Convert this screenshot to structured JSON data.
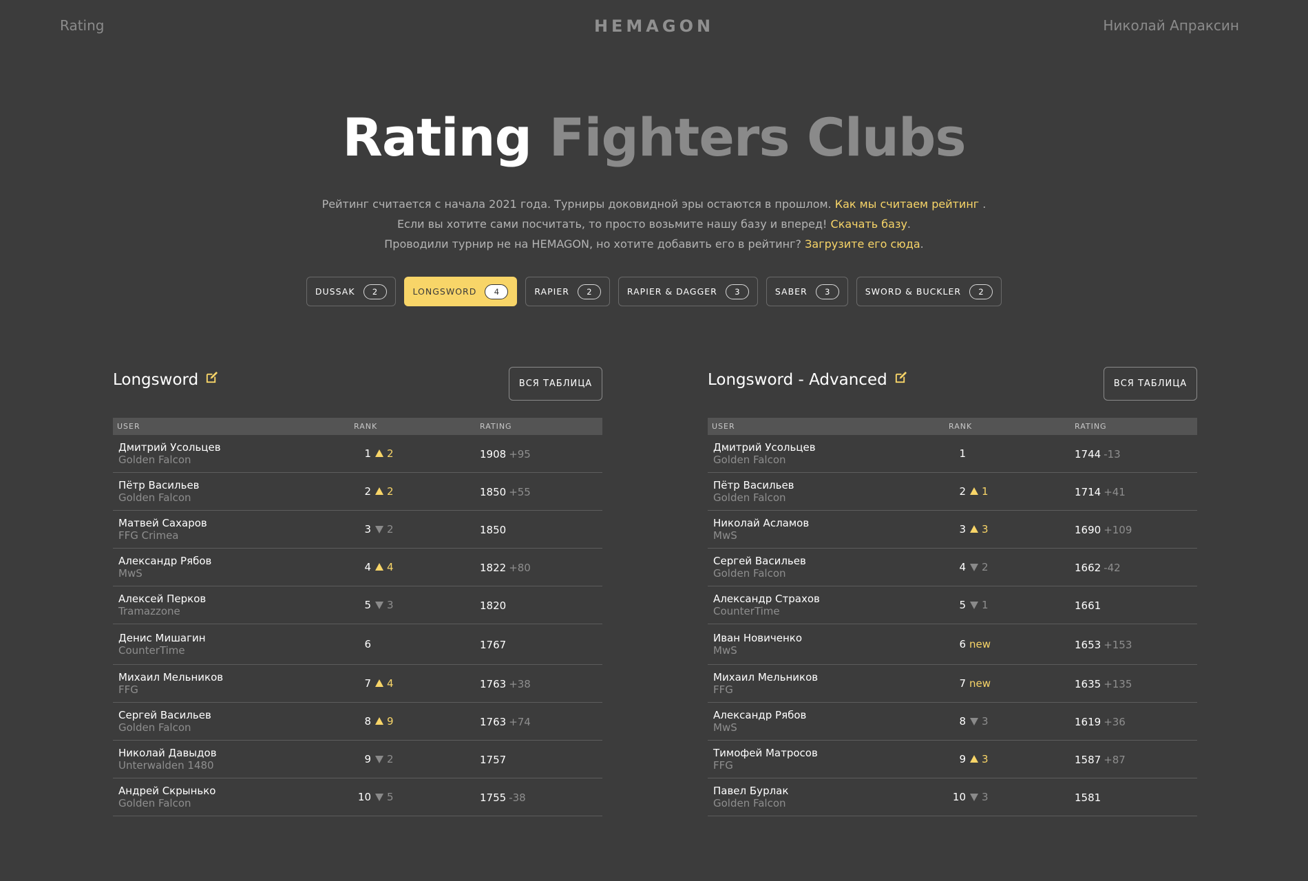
{
  "header": {
    "nav_rating": "Rating",
    "logo": "HEMAGON",
    "user_name": "Николай Апраксин"
  },
  "hero": {
    "title_part1": "Rating",
    "title_part2": "Fighters Clubs"
  },
  "intro": {
    "line1_text": "Рейтинг считается с начала 2021 года. Турниры доковидной эры остаются в прошлом.",
    "line1_link": "Как мы считаем рейтинг",
    "line1_suffix": ".",
    "line2_text": "Если вы хотите сами посчитать, то просто возьмите нашу базу и вперед!",
    "line2_link": "Скачать базу",
    "line2_suffix": ".",
    "line3_text": "Проводили турнир не на HEMAGON, но хотите добавить его в рейтинг?",
    "line3_link": "Загрузите его сюда",
    "line3_suffix": "."
  },
  "tabs": [
    {
      "label": "DUSSAK",
      "count": "2",
      "active": false
    },
    {
      "label": "LONGSWORD",
      "count": "4",
      "active": true
    },
    {
      "label": "RAPIER",
      "count": "2",
      "active": false
    },
    {
      "label": "RAPIER & DAGGER",
      "count": "3",
      "active": false
    },
    {
      "label": "SABER",
      "count": "3",
      "active": false
    },
    {
      "label": "SWORD & BUCKLER",
      "count": "2",
      "active": false
    }
  ],
  "colors": {
    "background": "#3c3c3c",
    "accent": "#f8d568",
    "table_header": "#545454",
    "muted_text": "#8e8e8e"
  },
  "icons": {
    "edit": "edit-icon",
    "rank_up": "triangle-up-icon",
    "rank_down": "triangle-down-icon"
  },
  "panels": [
    {
      "title": "Longsword",
      "full_table_label": "ВСЯ ТАБЛИЦА",
      "columns": {
        "user": "USER",
        "rank": "RANK",
        "rating": "RATING"
      },
      "rows": [
        {
          "name": "Дмитрий Усольцев",
          "club": "Golden Falcon",
          "rank": "1",
          "dir": "up",
          "delta": "2",
          "rating": "1908",
          "rating_delta": "+95"
        },
        {
          "name": "Пётр Васильев",
          "club": "Golden Falcon",
          "rank": "2",
          "dir": "up",
          "delta": "2",
          "rating": "1850",
          "rating_delta": "+55"
        },
        {
          "name": "Матвей Сахаров",
          "club": "FFG Crimea",
          "rank": "3",
          "dir": "down",
          "delta": "2",
          "rating": "1850",
          "rating_delta": ""
        },
        {
          "name": "Александр Рябов",
          "club": "MwS",
          "rank": "4",
          "dir": "up",
          "delta": "4",
          "rating": "1822",
          "rating_delta": "+80"
        },
        {
          "name": "Алексей Перков",
          "club": "Tramazzone",
          "rank": "5",
          "dir": "down",
          "delta": "3",
          "rating": "1820",
          "rating_delta": ""
        },
        {
          "name": "Денис Мишагин",
          "club": "CounterTime",
          "rank": "6",
          "dir": "none",
          "delta": "",
          "rating": "1767",
          "rating_delta": ""
        },
        {
          "name": "Михаил Мельников",
          "club": "FFG",
          "rank": "7",
          "dir": "up",
          "delta": "4",
          "rating": "1763",
          "rating_delta": "+38"
        },
        {
          "name": "Сергей Васильев",
          "club": "Golden Falcon",
          "rank": "8",
          "dir": "up",
          "delta": "9",
          "rating": "1763",
          "rating_delta": "+74"
        },
        {
          "name": "Николай Давыдов",
          "club": "Unterwalden 1480",
          "rank": "9",
          "dir": "down",
          "delta": "2",
          "rating": "1757",
          "rating_delta": ""
        },
        {
          "name": "Андрей Скрынько",
          "club": "Golden Falcon",
          "rank": "10",
          "dir": "down",
          "delta": "5",
          "rating": "1755",
          "rating_delta": "-38"
        }
      ]
    },
    {
      "title": "Longsword - Advanced",
      "full_table_label": "ВСЯ ТАБЛИЦА",
      "columns": {
        "user": "USER",
        "rank": "RANK",
        "rating": "RATING"
      },
      "rows": [
        {
          "name": "Дмитрий Усольцев",
          "club": "Golden Falcon",
          "rank": "1",
          "dir": "none",
          "delta": "",
          "rating": "1744",
          "rating_delta": "-13"
        },
        {
          "name": "Пётр Васильев",
          "club": "Golden Falcon",
          "rank": "2",
          "dir": "up",
          "delta": "1",
          "rating": "1714",
          "rating_delta": "+41"
        },
        {
          "name": "Николай Асламов",
          "club": "MwS",
          "rank": "3",
          "dir": "up",
          "delta": "3",
          "rating": "1690",
          "rating_delta": "+109"
        },
        {
          "name": "Сергей Васильев",
          "club": "Golden Falcon",
          "rank": "4",
          "dir": "down",
          "delta": "2",
          "rating": "1662",
          "rating_delta": "-42"
        },
        {
          "name": "Александр Страхов",
          "club": "CounterTime",
          "rank": "5",
          "dir": "down",
          "delta": "1",
          "rating": "1661",
          "rating_delta": ""
        },
        {
          "name": "Иван Новиченко",
          "club": "MwS",
          "rank": "6",
          "dir": "new",
          "delta": "new",
          "rating": "1653",
          "rating_delta": "+153"
        },
        {
          "name": "Михаил Мельников",
          "club": "FFG",
          "rank": "7",
          "dir": "new",
          "delta": "new",
          "rating": "1635",
          "rating_delta": "+135"
        },
        {
          "name": "Александр Рябов",
          "club": "MwS",
          "rank": "8",
          "dir": "down",
          "delta": "3",
          "rating": "1619",
          "rating_delta": "+36"
        },
        {
          "name": "Тимофей Матросов",
          "club": "FFG",
          "rank": "9",
          "dir": "up",
          "delta": "3",
          "rating": "1587",
          "rating_delta": "+87"
        },
        {
          "name": "Павел Бурлак",
          "club": "Golden Falcon",
          "rank": "10",
          "dir": "down",
          "delta": "3",
          "rating": "1581",
          "rating_delta": ""
        }
      ]
    }
  ]
}
